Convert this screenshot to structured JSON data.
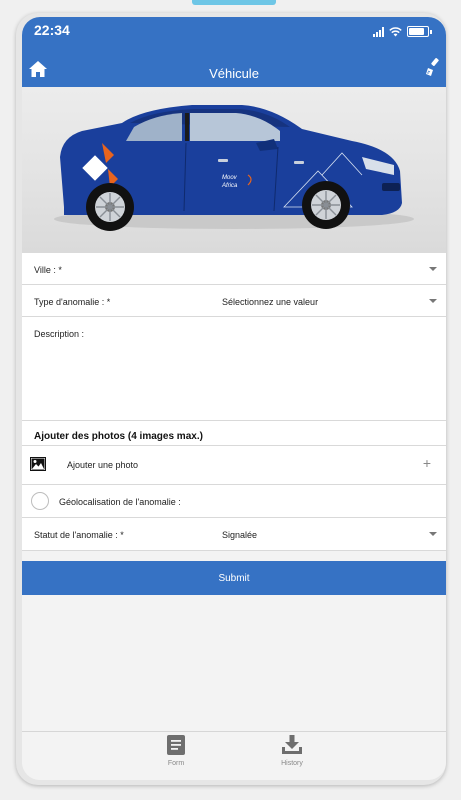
{
  "status_bar": {
    "time": "22:34"
  },
  "header": {
    "title": "Véhicule",
    "home_icon": "home-icon",
    "brush_icon": "brush-icon"
  },
  "hero": {
    "logo_line1": "Moov",
    "logo_line2": "Africa"
  },
  "form": {
    "ville_label": "Ville : *",
    "type_label": "Type d'anomalie : *",
    "type_placeholder": "Sélectionnez une valeur",
    "description_label": "Description :",
    "photos_title": "Ajouter des photos (4 images max.)",
    "add_photo_label": "Ajouter une photo",
    "add_photo_plus": "+",
    "geo_label": "Géolocalisation de l'anomalie :",
    "statut_label": "Statut de l'anomalie : *",
    "statut_value": "Signalée",
    "submit_label": "Submit"
  },
  "tab_bar": {
    "items": [
      {
        "label": "Form",
        "icon": "form-icon"
      },
      {
        "label": "History",
        "icon": "download-icon"
      }
    ]
  },
  "colors": {
    "primary": "#3672c4",
    "car_body": "#1a3f9c",
    "accent_orange": "#e8641e"
  }
}
